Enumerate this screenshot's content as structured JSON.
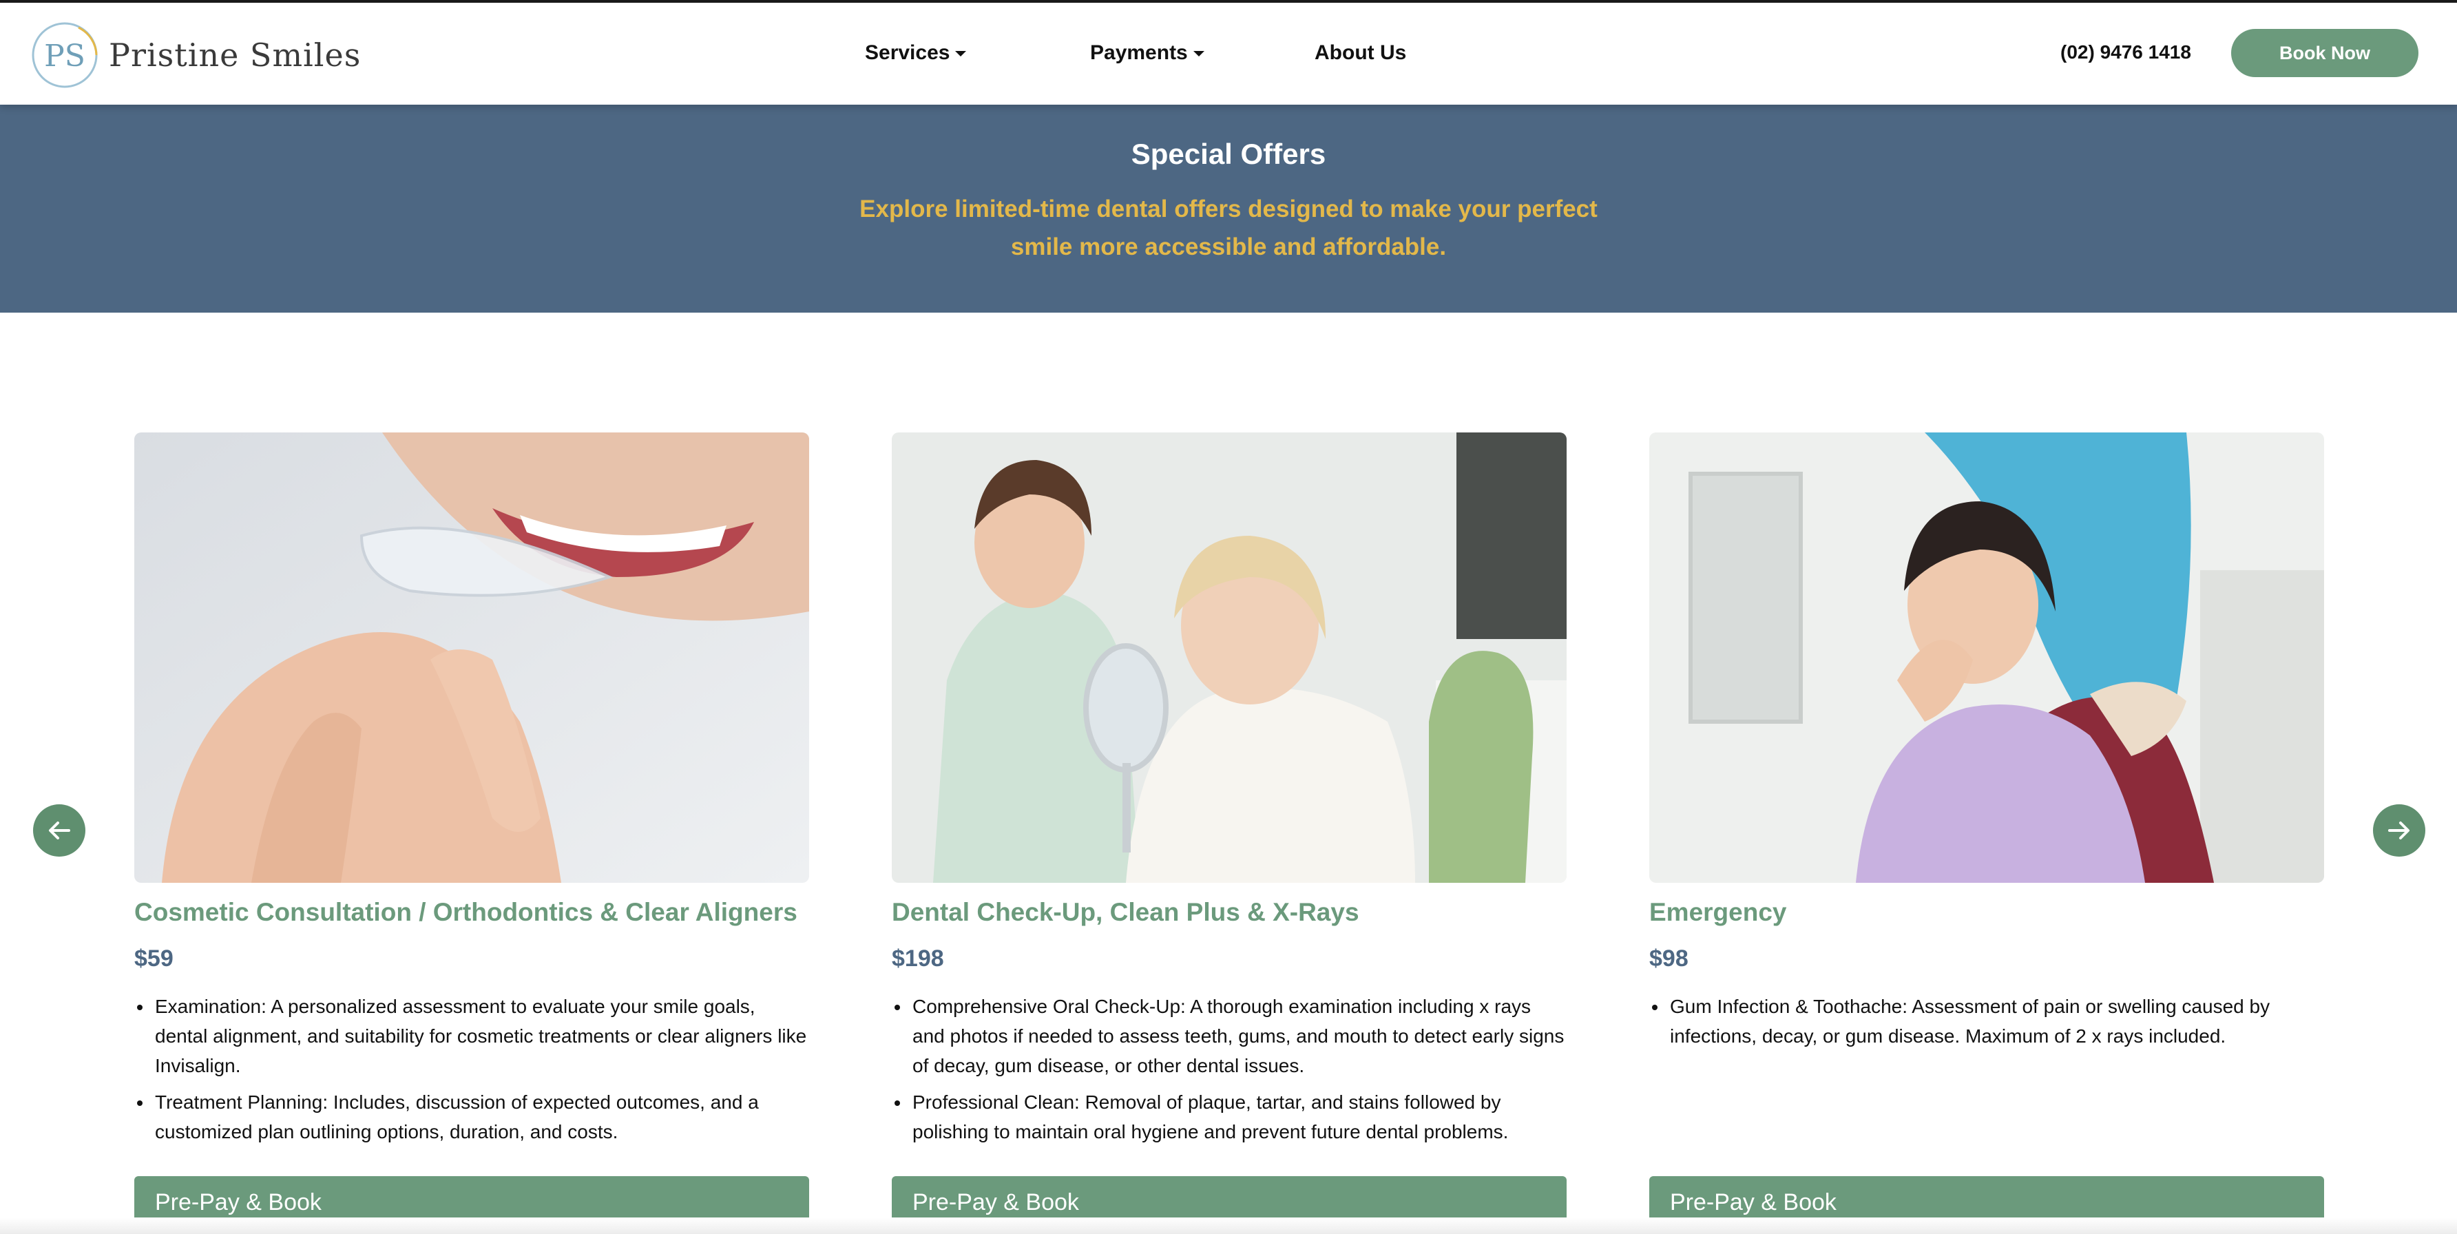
{
  "brand": {
    "monogram": "PS",
    "name": "Pristine Smiles"
  },
  "nav": {
    "items": [
      {
        "label": "Services",
        "dropdown": true
      },
      {
        "label": "Payments",
        "dropdown": true
      },
      {
        "label": "About Us",
        "dropdown": false
      }
    ]
  },
  "header": {
    "phone": "(02) 9476 1418",
    "book_now": "Book Now"
  },
  "banner": {
    "title": "Special Offers",
    "subtitle": "Explore limited-time dental offers designed to make your perfect smile more accessible and affordable."
  },
  "offers": [
    {
      "title": "Cosmetic Consultation / Orthodontics & Clear Aligners",
      "price": "$59",
      "bullets": [
        "Examination: A personalized assessment to evaluate your smile goals, dental alignment, and suitability for cosmetic treatments or clear aligners like Invisalign.",
        "Treatment Planning: Includes, discussion of expected outcomes, and a customized plan outlining options, duration, and costs."
      ],
      "button": "Pre-Pay & Book",
      "image": "clear-aligner-photo"
    },
    {
      "title": "Dental Check-Up, Clean Plus & X-Rays",
      "price": "$198",
      "bullets": [
        "Comprehensive Oral Check-Up: A thorough examination including x rays and photos if needed to assess teeth, gums, and mouth to detect early signs of decay, gum disease, or other dental issues.",
        "Professional Clean: Removal of plaque, tartar, and stains followed by polishing to maintain oral hygiene and prevent future dental problems."
      ],
      "button": "Pre-Pay & Book",
      "image": "dental-checkup-photo"
    },
    {
      "title": "Emergency",
      "price": "$98",
      "bullets": [
        "Gum Infection & Toothache: Assessment of pain or swelling caused by infections, decay, or gum disease. Maximum of 2 x rays included."
      ],
      "button": "Pre-Pay & Book",
      "image": "toothache-patient-photo"
    }
  ],
  "carousel": {
    "prev_icon": "arrow-left-icon",
    "next_icon": "arrow-right-icon"
  },
  "colors": {
    "brand_green": "#6b9a7c",
    "banner_blue": "#4d6783",
    "banner_gold": "#e3b84a",
    "price_blue": "#4d6783"
  }
}
